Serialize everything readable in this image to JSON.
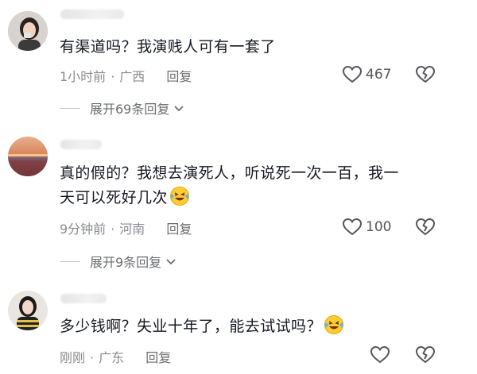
{
  "comments": [
    {
      "text": "有渠道吗？我演贱人可有一套了",
      "time": "1小时前",
      "location": "广西",
      "reply_label": "回复",
      "likes": "467",
      "expand_label": "展开69条回复"
    },
    {
      "text_line1": "真的假的？我想去演死人，听说死一次一百，我一",
      "text_line2": "天可以死好几次",
      "time": "9分钟前",
      "location": "河南",
      "reply_label": "回复",
      "likes": "100",
      "expand_label": "展开9条回复"
    },
    {
      "text": "多少钱啊？失业十年了，能去试试吗？",
      "time": "刚刚",
      "location": "广东",
      "reply_label": "回复",
      "likes": ""
    }
  ],
  "separator": "·",
  "icons": {
    "like": "heart-outline-icon",
    "dislike": "broken-heart-icon",
    "expand": "chevron-down-icon",
    "emoji": "laughing-tears-emoji-icon"
  },
  "colors": {
    "text": "#161823",
    "meta": "#8a8b91",
    "expand": "#6b6c72"
  }
}
